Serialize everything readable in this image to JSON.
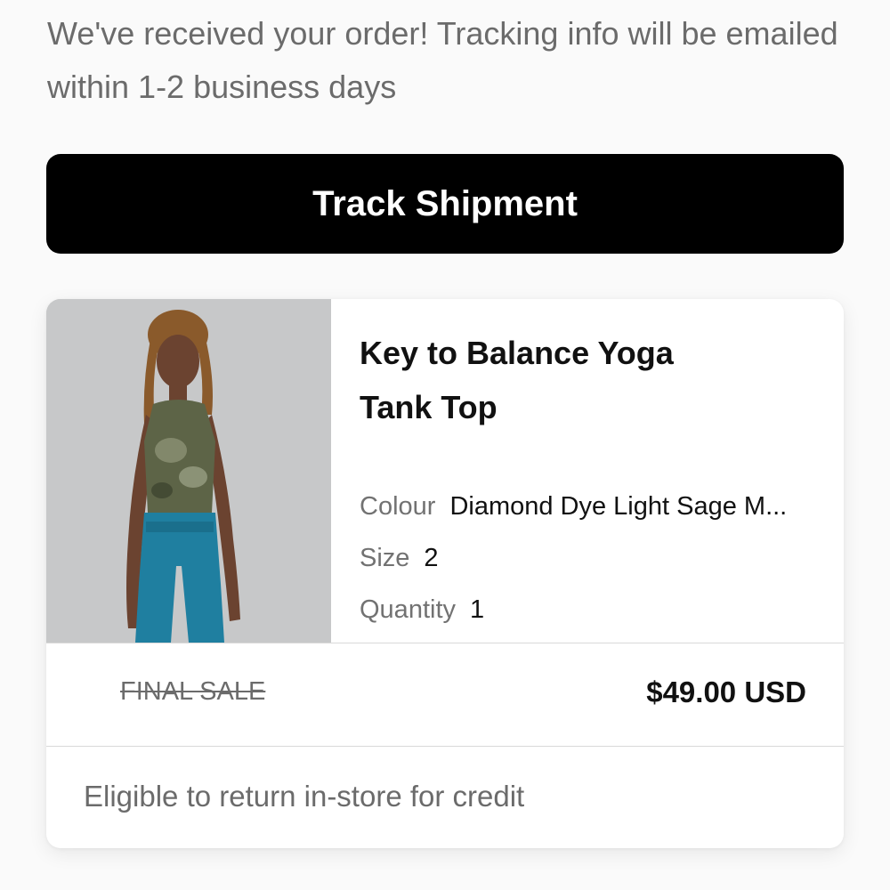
{
  "confirmation": {
    "message": "We've received your order! Tracking info will be emailed within 1-2 business days"
  },
  "actions": {
    "track_label": "Track Shipment"
  },
  "order_item": {
    "image_icon": "product-photo",
    "name": "Key to Balance Yoga Tank Top",
    "attributes": [
      {
        "label": "Colour",
        "value": "Diamond Dye Light Sage M..."
      },
      {
        "label": "Size",
        "value": "2"
      },
      {
        "label": "Quantity",
        "value": "1"
      }
    ],
    "sale_label": "FINAL SALE",
    "price": "$49.00 USD",
    "return_note": "Eligible to return in-store for credit"
  },
  "colors": {
    "button_bg": "#000000",
    "muted_text": "#6b6b6b",
    "page_bg": "#fafafa"
  }
}
